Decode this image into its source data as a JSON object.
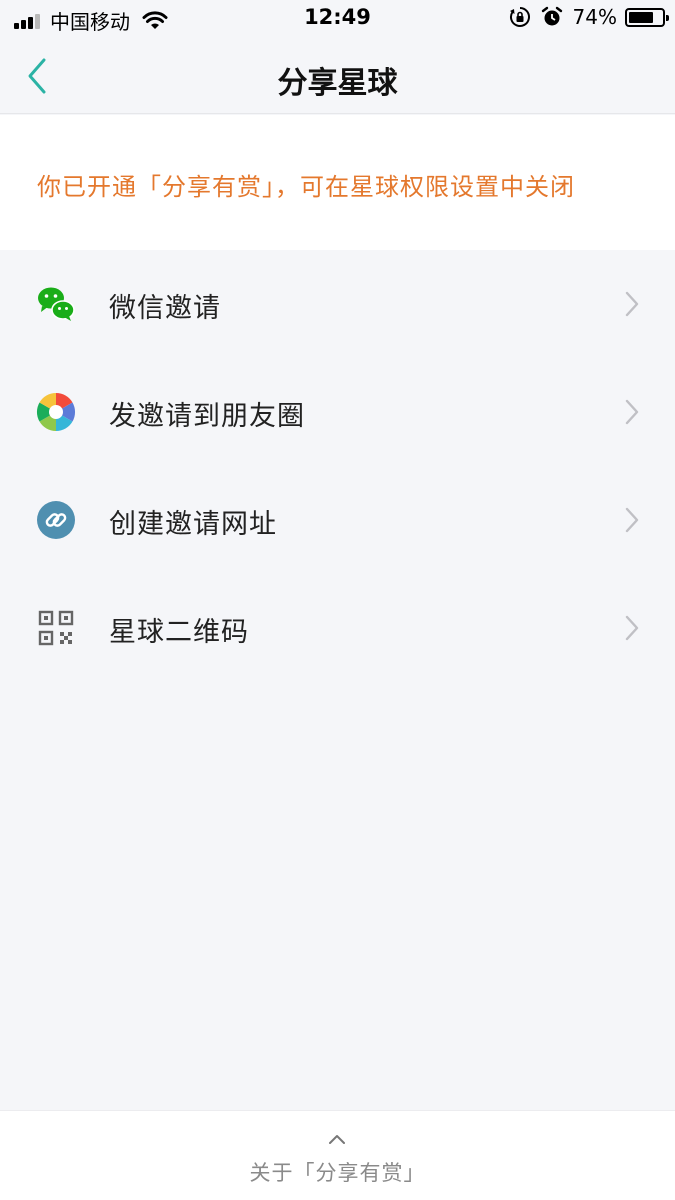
{
  "status_bar": {
    "carrier": "中国移动",
    "time": "12:49",
    "battery_percent_label": "74%",
    "battery_level": 0.74
  },
  "nav": {
    "title": "分享星球"
  },
  "notice": {
    "text": "你已开通「分享有赏」，可在星球权限设置中关闭",
    "color": "#e4782d"
  },
  "menu": {
    "items": [
      {
        "label": "微信邀请",
        "icon": "wechat-icon"
      },
      {
        "label": "发邀请到朋友圈",
        "icon": "moments-icon"
      },
      {
        "label": "创建邀请网址",
        "icon": "link-icon"
      },
      {
        "label": "星球二维码",
        "icon": "qr-code-icon"
      }
    ]
  },
  "footer": {
    "text": "关于「分享有赏」"
  },
  "colors": {
    "accent": "#2bb3a5",
    "wechat": "#1aad19",
    "link_icon_bg": "#4f8fb0"
  }
}
